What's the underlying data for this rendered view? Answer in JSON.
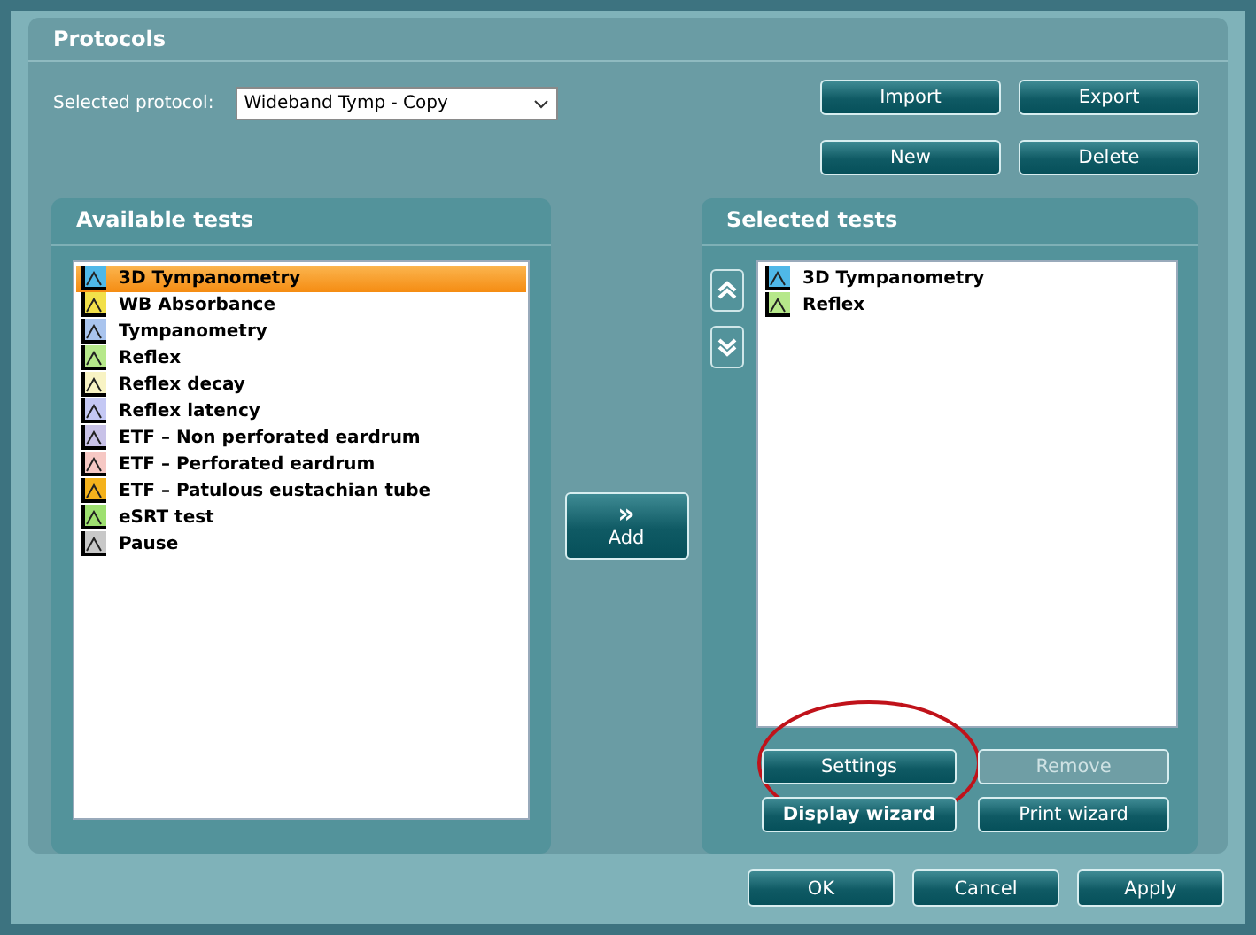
{
  "title": "Protocols",
  "selected_protocol": {
    "label": "Selected protocol:",
    "value": "Wideband Tymp - Copy"
  },
  "top_buttons": [
    {
      "label": "Import",
      "disabled": false
    },
    {
      "label": "Export",
      "disabled": false
    },
    {
      "label": "New",
      "disabled": false
    },
    {
      "label": "Delete",
      "disabled": false
    }
  ],
  "available_tests": {
    "title": "Available tests",
    "items": [
      {
        "label": "3D Tympanometry",
        "color": "#4fb8e8",
        "selected": true
      },
      {
        "label": "WB Absorbance",
        "color": "#f2e04a",
        "selected": false
      },
      {
        "label": "Tympanometry",
        "color": "#a9c4ee",
        "selected": false
      },
      {
        "label": "Reflex",
        "color": "#b6e88a",
        "selected": false
      },
      {
        "label": "Reflex decay",
        "color": "#f8f3c4",
        "selected": false
      },
      {
        "label": "Reflex latency",
        "color": "#c4c8f4",
        "selected": false
      },
      {
        "label": "ETF – Non perforated eardrum",
        "color": "#c8c2e8",
        "selected": false
      },
      {
        "label": "ETF – Perforated eardrum",
        "color": "#f6c8c4",
        "selected": false
      },
      {
        "label": "ETF – Patulous eustachian tube",
        "color": "#f4b21c",
        "selected": false
      },
      {
        "label": "eSRT test",
        "color": "#9ee070",
        "selected": false
      },
      {
        "label": "Pause",
        "color": "#c8c8c8",
        "selected": false
      }
    ]
  },
  "add_button": {
    "label": "Add",
    "icon": "»"
  },
  "selected_tests": {
    "title": "Selected tests",
    "items": [
      {
        "label": "3D Tympanometry",
        "color": "#4fb8e8",
        "selected": false
      },
      {
        "label": "Reflex",
        "color": "#b6e88a",
        "selected": false
      }
    ],
    "buttons": [
      {
        "label": "Settings",
        "disabled": false,
        "bold": false
      },
      {
        "label": "Remove",
        "disabled": true,
        "bold": false
      },
      {
        "label": "Display wizard",
        "disabled": false,
        "bold": true
      },
      {
        "label": "Print wizard",
        "disabled": false,
        "bold": false
      }
    ]
  },
  "dialog_buttons": [
    {
      "label": "OK",
      "disabled": false
    },
    {
      "label": "Cancel",
      "disabled": false
    },
    {
      "label": "Apply",
      "disabled": false
    }
  ],
  "annotation": {
    "kind": "ellipse",
    "color": "#c0121a"
  }
}
